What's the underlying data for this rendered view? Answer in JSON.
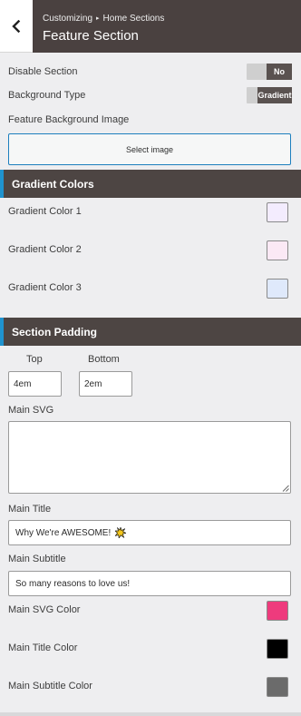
{
  "header": {
    "breadcrumb_parent": "Customizing",
    "breadcrumb_separator": "▸",
    "breadcrumb_current": "Home Sections",
    "title": "Feature Section"
  },
  "disable_section": {
    "label": "Disable Section",
    "value": "No"
  },
  "background_type": {
    "label": "Background Type",
    "value": "Gradient"
  },
  "feature_background": {
    "label": "Feature Background Image",
    "button": "Select image"
  },
  "gradient_colors": {
    "heading": "Gradient Colors",
    "items": [
      {
        "label": "Gradient Color 1",
        "color": "#f3ecfe"
      },
      {
        "label": "Gradient Color 2",
        "color": "#fbe9f5"
      },
      {
        "label": "Gradient Color 3",
        "color": "#dfe9fb"
      }
    ]
  },
  "section_padding": {
    "heading": "Section Padding",
    "top_label": "Top",
    "top_value": "4em",
    "bottom_label": "Bottom",
    "bottom_value": "2em"
  },
  "main_svg": {
    "label": "Main SVG",
    "value": ""
  },
  "main_title": {
    "label": "Main Title",
    "value": "Why We're AWESOME!",
    "emoji_icon": "sparkle-burst-icon"
  },
  "main_subtitle": {
    "label": "Main Subtitle",
    "value": "So many reasons to love us!"
  },
  "colors": [
    {
      "label": "Main SVG Color",
      "color": "#ee3b7d"
    },
    {
      "label": "Main Title Color",
      "color": "#000000"
    },
    {
      "label": "Main Subtitle Color",
      "color": "#6b6b6b"
    }
  ],
  "theme": {
    "header_bg": "#4a4140",
    "accent": "#1f93cf",
    "section_bar_bg": "#4d4543"
  }
}
